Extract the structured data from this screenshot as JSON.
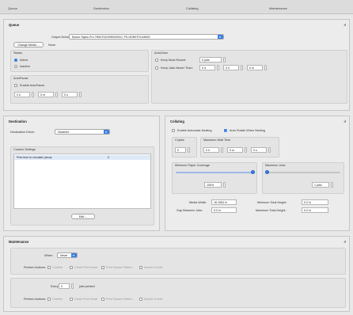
{
  "tabs": [
    "Queue",
    "Destination",
    "Collating",
    "Maintenance"
  ],
  "queue": {
    "title": "Queue",
    "output_driver_label": "Output Driver:",
    "output_driver_value": "Epson Stylus Pro 7900/7910/9900/9910, PK-HDR/HTX/18000",
    "change_media_label": "Change Media ...",
    "change_media_value": "None",
    "status": {
      "title": "Status",
      "active_label": "Active",
      "inactive_label": "Inactive",
      "selected": "Active"
    },
    "autoclear": {
      "title": "AutoClear",
      "keep_most_recent_label": "Keep Most Recent:",
      "keep_most_recent_value": "0 jobs",
      "keep_jobs_newer_label": "Keep Jobs Newer Than:",
      "newer_d": "0 d",
      "newer_h": "0 h",
      "newer_m": "0 m"
    },
    "autopause": {
      "title": "AutoPause",
      "enable_label": "Enable AutoPause",
      "h": "0 h",
      "m": "0 m",
      "s": "0 s"
    }
  },
  "destination": {
    "title": "Destination",
    "driver_label": "Destination Driver:",
    "driver_value": "Nowhere",
    "custom_settings_title": "Custom Settings",
    "rows": [
      {
        "name": "Print time to simulate (secs):",
        "value": "0"
      }
    ],
    "edit_label": "Edit ..."
  },
  "collating": {
    "title": "Collating",
    "enable_nesting_label": "Enable Automatic Nesting",
    "auto_rotate_label": "Auto Rotate When Nesting",
    "auto_rotate_checked": true,
    "copies_title": "Copies",
    "copies_value": "0",
    "max_wait_title": "Maximum Wait Time",
    "wait_h": "0 h",
    "wait_m": "0 m",
    "wait_s": "0 s",
    "min_coverage_title": "Minimum Paper Coverage",
    "min_coverage_value": "100%",
    "min_coverage_fraction": 1.0,
    "max_jobs_title": "Maximum Jobs",
    "max_jobs_value": "1 jobs",
    "max_jobs_fraction": 0.0,
    "media_width_label": "Media Width:",
    "media_width_value": "16.1554 in",
    "min_total_height_label": "Minimum Total Height:",
    "min_total_height_value": "0.0 in",
    "gap_label": "Gap Between Jobs:",
    "gap_value": "0.0 in",
    "max_total_height_label": "Maximum Total Height:",
    "max_total_height_value": "0.0 in"
  },
  "maintenance": {
    "title": "Maintenance",
    "when_label": "When:",
    "when_value": "Never",
    "perform_label": "Perform Actions:",
    "actions": [
      "Confirm",
      "Clean Print Head",
      "Print Nozzle Pattern",
      "Nozzle Check"
    ],
    "every_label": "Every",
    "every_value": "0",
    "every_unit": "jobs printed",
    "perform_label_2": "Perform Actions:",
    "actions_2": [
      "Confirm",
      "Clean Print Head",
      "Print Nozzle Pattern",
      "Nozzle Check"
    ]
  }
}
